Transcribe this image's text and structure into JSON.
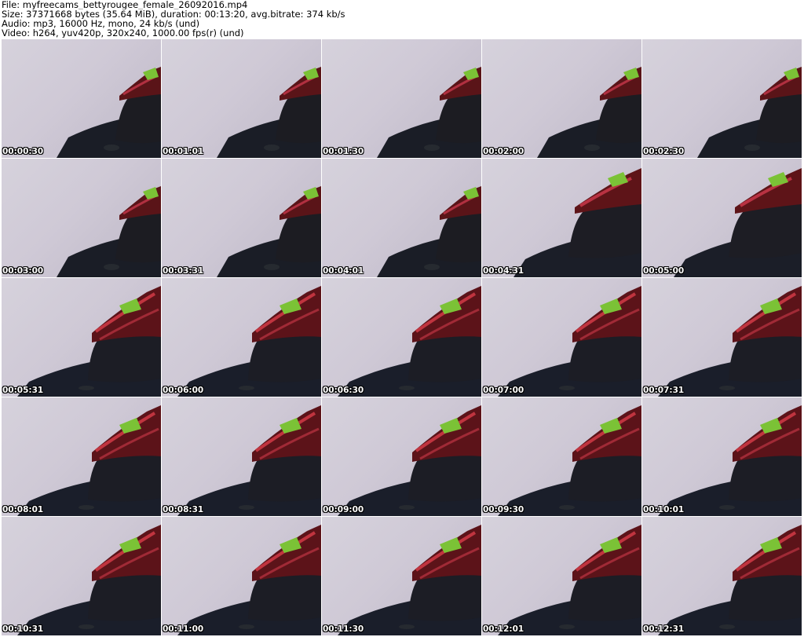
{
  "header": {
    "line1": "File: myfreecams_bettyrougee_female_26092016.mp4",
    "line2": "Size: 37371668 bytes (35.64 MiB), duration: 00:13:20, avg.bitrate: 374 kb/s",
    "line3": "Audio: mp3, 16000 Hz, mono, 24 kb/s (und)",
    "line4": "Video: h264, yuv420p, 320x240, 1000.00 fps(r) (und)"
  },
  "thumbnails": [
    {
      "timestamp": "00:00:30",
      "variant": "a"
    },
    {
      "timestamp": "00:01:01",
      "variant": "a"
    },
    {
      "timestamp": "00:01:30",
      "variant": "a"
    },
    {
      "timestamp": "00:02:00",
      "variant": "a"
    },
    {
      "timestamp": "00:02:30",
      "variant": "a"
    },
    {
      "timestamp": "00:03:00",
      "variant": "a"
    },
    {
      "timestamp": "00:03:31",
      "variant": "a"
    },
    {
      "timestamp": "00:04:01",
      "variant": "a"
    },
    {
      "timestamp": "00:04:31",
      "variant": "b"
    },
    {
      "timestamp": "00:05:00",
      "variant": "b"
    },
    {
      "timestamp": "00:05:31",
      "variant": "c"
    },
    {
      "timestamp": "00:06:00",
      "variant": "c"
    },
    {
      "timestamp": "00:06:30",
      "variant": "c"
    },
    {
      "timestamp": "00:07:00",
      "variant": "c"
    },
    {
      "timestamp": "00:07:31",
      "variant": "c"
    },
    {
      "timestamp": "00:08:01",
      "variant": "c"
    },
    {
      "timestamp": "00:08:31",
      "variant": "c"
    },
    {
      "timestamp": "00:09:00",
      "variant": "c"
    },
    {
      "timestamp": "00:09:30",
      "variant": "c"
    },
    {
      "timestamp": "00:10:01",
      "variant": "c"
    },
    {
      "timestamp": "00:10:31",
      "variant": "c"
    },
    {
      "timestamp": "00:11:00",
      "variant": "c"
    },
    {
      "timestamp": "00:11:30",
      "variant": "c"
    },
    {
      "timestamp": "00:12:01",
      "variant": "c"
    },
    {
      "timestamp": "00:12:31",
      "variant": "c"
    }
  ]
}
